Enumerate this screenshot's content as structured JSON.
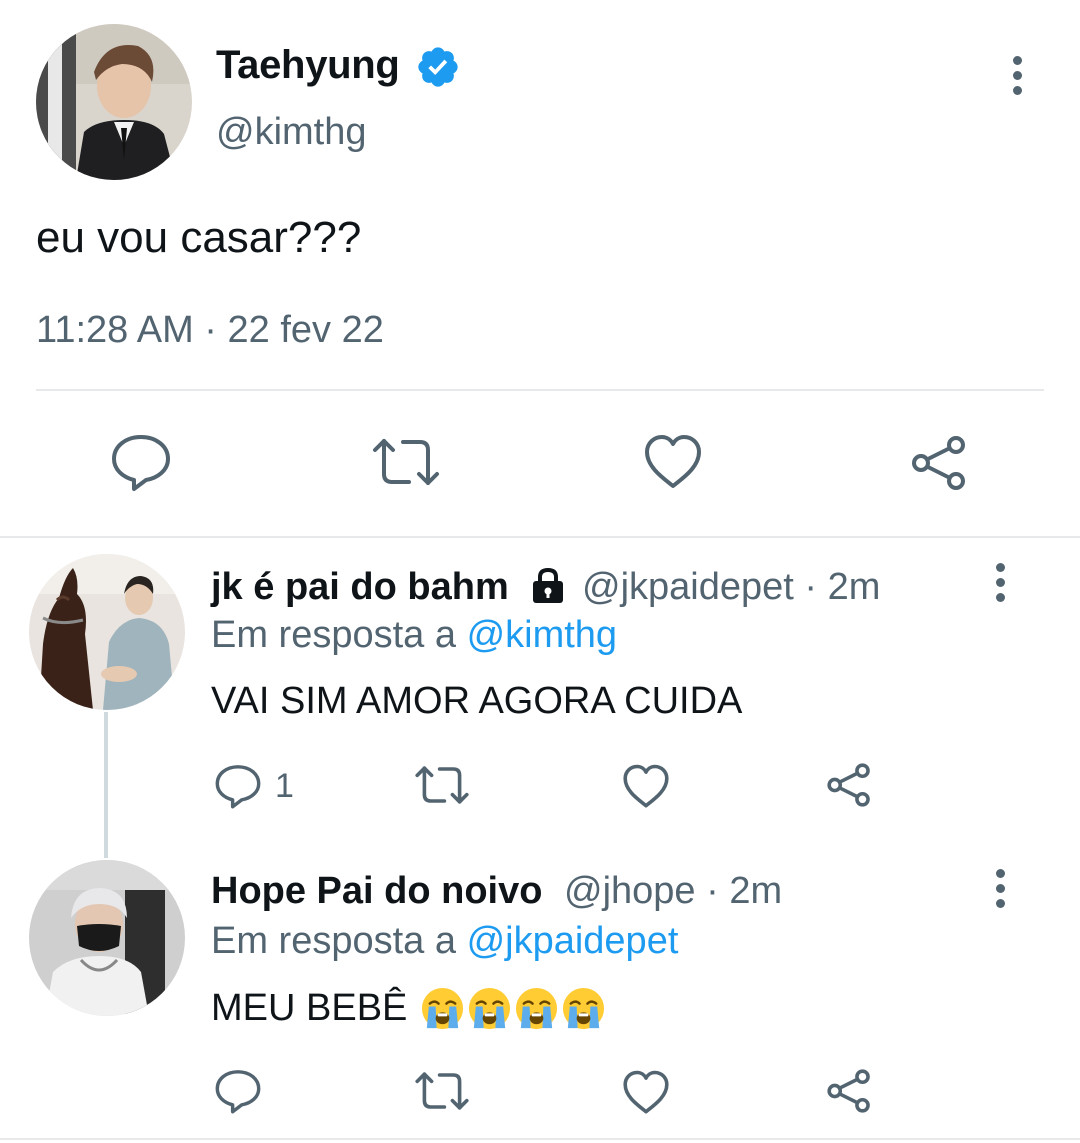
{
  "main_tweet": {
    "author_name": "Taehyung",
    "handle": "@kimthg",
    "text": "eu vou casar???",
    "timestamp": "11:28 AM · 22 fev 22",
    "verified_icon": "verified-badge-icon",
    "actions": [
      "reply-icon",
      "retweet-icon",
      "like-icon",
      "share-icon"
    ]
  },
  "replies": [
    {
      "author_name": "jk é pai do bahm",
      "protected_icon": "lock-icon",
      "handle_time": "@jkpaidepet · 2m",
      "in_reply_prefix": "Em resposta a",
      "in_reply_handle": "@kimthg",
      "text": "VAI SIM AMOR AGORA CUIDA",
      "reply_count": "1"
    },
    {
      "author_name": "Hope Pai do noivo",
      "handle_time": "@jhope · 2m",
      "in_reply_prefix": "Em resposta a",
      "in_reply_handle": "@jkpaidepet",
      "text": "MEU BEBÊ",
      "emojis": [
        "loudly-crying-face",
        "loudly-crying-face",
        "loudly-crying-face",
        "loudly-crying-face"
      ]
    }
  ],
  "colors": {
    "text_primary": "#0f1419",
    "text_secondary": "#536471",
    "link": "#1d9bf0",
    "divider": "#e7e9ea",
    "thread_line": "#cfd9de"
  }
}
